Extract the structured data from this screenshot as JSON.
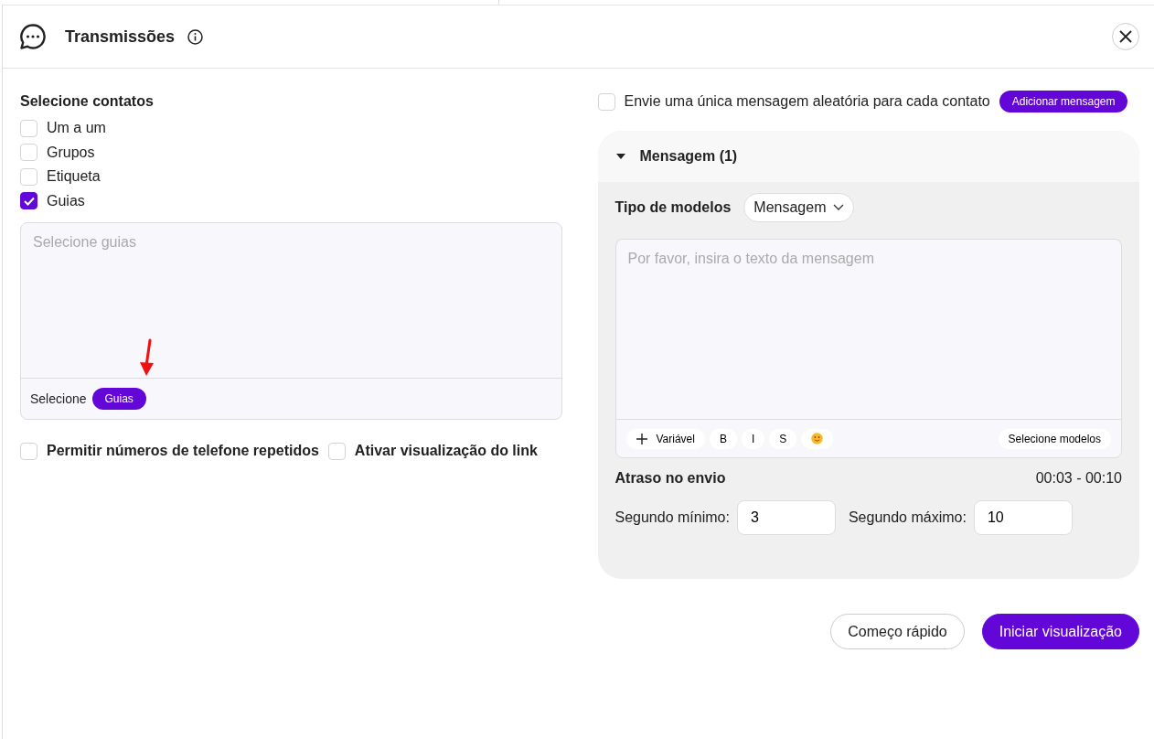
{
  "dialog": {
    "title": "Transmissões"
  },
  "contacts": {
    "heading": "Selecione contatos",
    "options": [
      {
        "label": "Um a um",
        "checked": false
      },
      {
        "label": "Grupos",
        "checked": false
      },
      {
        "label": "Etiqueta",
        "checked": false
      },
      {
        "label": "Guias",
        "checked": true
      }
    ],
    "tabs_field": {
      "placeholder": "Selecione guias",
      "footer_label": "Selecione",
      "footer_button": "Guias"
    }
  },
  "options": [
    {
      "label": "Permitir números de telefone repetidos",
      "checked": false
    },
    {
      "label": "Ativar visualização do link",
      "checked": false
    }
  ],
  "random_message": {
    "label": "Envie uma única mensagem aleatória para cada contato",
    "checked": false,
    "button": "Adicionar mensagem"
  },
  "message_panel": {
    "title": "Mensagem (1)",
    "expanded": true,
    "template_type_label": "Tipo de modelos",
    "template_type": "Mensagem",
    "message_placeholder": "Por favor, insira o texto da mensagem",
    "toolbar": [
      {
        "kind": "variable",
        "label": "Variável"
      },
      {
        "kind": "text",
        "label": "B"
      },
      {
        "kind": "text",
        "label": "I"
      },
      {
        "kind": "text",
        "label": "S"
      },
      {
        "kind": "emoji"
      }
    ],
    "select_templates": "Selecione modelos",
    "delay_label": "Atraso no envio",
    "delay_range": "00:03 - 00:10",
    "min_label": "Segundo mínimo:",
    "min_value": "3",
    "max_label": "Segundo máximo:",
    "max_value": "10"
  },
  "footer_buttons": [
    {
      "label": "Começo rápido",
      "kind": "outline"
    },
    {
      "label": "Iniciar visualização",
      "kind": "primary"
    }
  ]
}
